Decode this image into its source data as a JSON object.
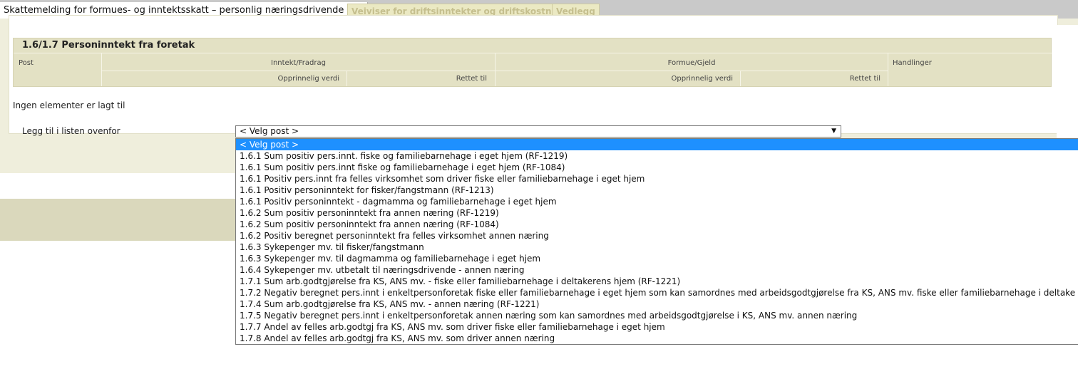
{
  "tabs": [
    {
      "label": "Skattemelding for formues- og inntektsskatt – personlig næringsdrivende mv.",
      "active": true
    },
    {
      "label": "Veiviser for driftsinntekter og driftskostnader",
      "active": false
    },
    {
      "label": "Vedlegg",
      "active": false
    }
  ],
  "section": {
    "title": "1.6/1.7 Personinntekt fra foretak",
    "headers": {
      "post": "Post",
      "inntekt": "Inntekt/Fradrag",
      "formue": "Formue/Gjeld",
      "handlinger": "Handlinger",
      "opprinnelig_1": "Opprinnelig verdi",
      "rettet_1": "Rettet til",
      "opprinnelig_2": "Opprinnelig verdi",
      "rettet_2": "Rettet til"
    },
    "empty_message": "Ingen elementer er lagt til",
    "add_label": "Legg til i listen ovenfor",
    "select_value": "< Velg post >",
    "select_arrow": "▼"
  },
  "dropdown_options": [
    "< Velg post >",
    "1.6.1 Sum positiv pers.innt. fiske og familiebarnehage i eget hjem (RF-1219)",
    "1.6.1 Sum positiv pers.innt fiske og familiebarnehage i eget hjem (RF-1084)",
    "1.6.1 Positiv pers.innt fra felles virksomhet som driver fiske eller familiebarnehage i eget hjem",
    "1.6.1 Positiv personinntekt for fisker/fangstmann (RF-1213)",
    "1.6.1 Positiv personinntekt - dagmamma og familiebarnehage i eget hjem",
    "1.6.2 Sum positiv personinntekt fra annen næring (RF-1219)",
    "1.6.2 Sum positiv personinntekt fra annen næring (RF-1084)",
    "1.6.2 Positiv beregnet personinntekt fra felles virksomhet annen næring",
    "1.6.3 Sykepenger mv. til fisker/fangstmann",
    "1.6.3 Sykepenger mv. til dagmamma og familiebarnehage i eget hjem",
    "1.6.4 Sykepenger mv. utbetalt til næringsdrivende - annen næring",
    "1.7.1 Sum arb.godtgjørelse fra KS, ANS mv. - fiske eller familiebarnehage i deltakerens hjem (RF-1221)",
    "1.7.2 Negativ beregnet pers.innt i enkeltpersonforetak fiske eller familiebarnehage i eget hjem som kan samordnes med arbeidsgodtgjørelse fra KS, ANS mv. fiske eller familiebarnehage i deltake",
    "1.7.4 Sum arb.godtgjørelse fra KS, ANS mv. - annen næring (RF-1221)",
    "1.7.5 Negativ beregnet pers.innt i enkeltpersonforetak annen næring som kan samordnes med arbeidsgodtgjørelse i KS, ANS mv. annen næring",
    "1.7.7 Andel av felles arb.godtgj fra KS, ANS mv. som driver fiske eller familiebarnehage i eget hjem",
    "1.7.8 Andel av felles arb.godtgj fra KS, ANS mv. som driver annen næring"
  ],
  "selected_option_index": 0
}
